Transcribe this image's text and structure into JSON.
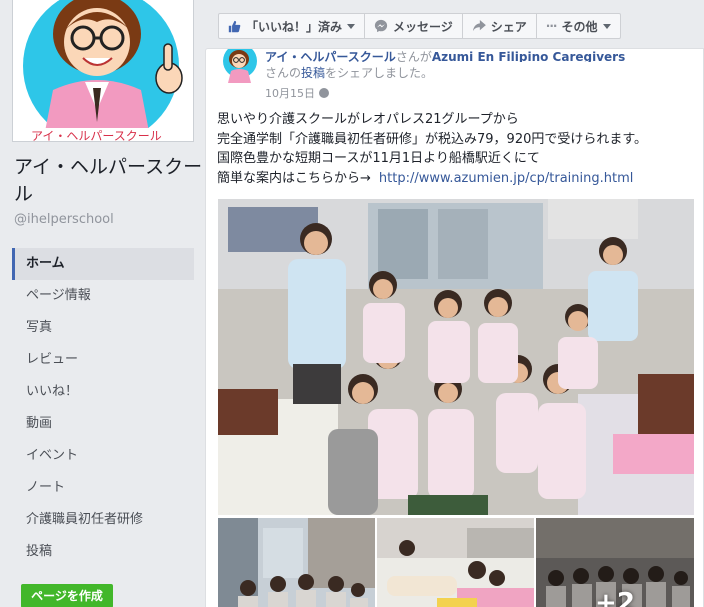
{
  "profile": {
    "name": "アイ・ヘルパースクール",
    "handle": "@ihelperschool",
    "pic_caption": "アイ・ヘルパースクール"
  },
  "nav": {
    "items": [
      {
        "label": "ホーム",
        "active": true
      },
      {
        "label": "ページ情報"
      },
      {
        "label": "写真"
      },
      {
        "label": "レビュー"
      },
      {
        "label": "いいね！"
      },
      {
        "label": "動画"
      },
      {
        "label": "イベント"
      },
      {
        "label": "ノート"
      },
      {
        "label": "介護職員初任者研修"
      },
      {
        "label": "投稿"
      }
    ]
  },
  "create_page_label": "ページを作成",
  "actions": {
    "liked": "「いいね！」済み",
    "message": "メッセージ",
    "share": "シェア",
    "more": "その他"
  },
  "post": {
    "header_line1_author": "アイ・ヘルパースクール",
    "header_line1_mid": "さんが",
    "header_line1_shared_from": "Azumi En Filipino Caregivers",
    "header_line2_prefix": "さんの",
    "header_line2_link": "投稿",
    "header_line2_suffix": "をシェアしました。",
    "date": "10月15日",
    "text_lines": [
      "思いやり介護スクールがレオパレス21グループから",
      "完全通学制「介護職員初任者研修」が税込み79，920円で受けられます。",
      "国際色豊かな短期コースが11月1日より船橋駅近くにて",
      "簡単な案内はこちらから→"
    ],
    "url": "http://www.azumien.jp/cp/training.html",
    "more_photos": "+2"
  },
  "colors": {
    "brand_blue": "#4267b2",
    "link_blue": "#365899",
    "green_button": "#42b72a",
    "background": "#e9ebee"
  }
}
